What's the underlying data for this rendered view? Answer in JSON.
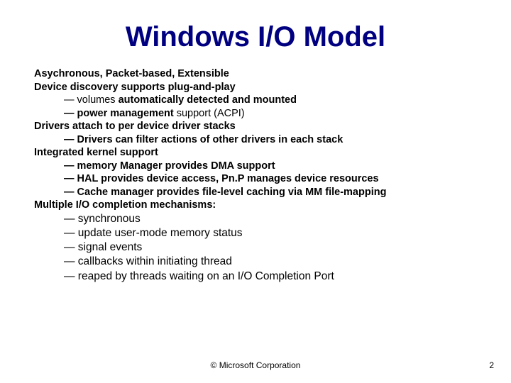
{
  "title": "Windows I/O Model",
  "h1": "Asychronous, Packet-based, Extensible",
  "h2": "Device discovery supports plug-and-play",
  "h2a_pre": "— volumes ",
  "h2a_bold": "automatically detected and mounted",
  "h2b_pre": "— power management ",
  "h2b_plain": "support (ACPI)",
  "h3": "Drivers attach to per device driver stacks",
  "h3a": "— Drivers can filter actions of other drivers in each stack",
  "h4": "Integrated kernel support",
  "h4a": "— memory Manager provides DMA support",
  "h4b": "— HAL provides device access, Pn.P manages device resources",
  "h4c": "— Cache manager provides file-level caching via MM file-mapping",
  "h5": "Multiple I/O completion mechanisms:",
  "m1": "— synchronous",
  "m2": "— update user-mode memory status",
  "m3": "— signal events",
  "m4": "— callbacks within initiating thread",
  "m5": "— reaped by threads waiting on an I/O Completion Port",
  "copyright": "© Microsoft Corporation",
  "page": "2"
}
